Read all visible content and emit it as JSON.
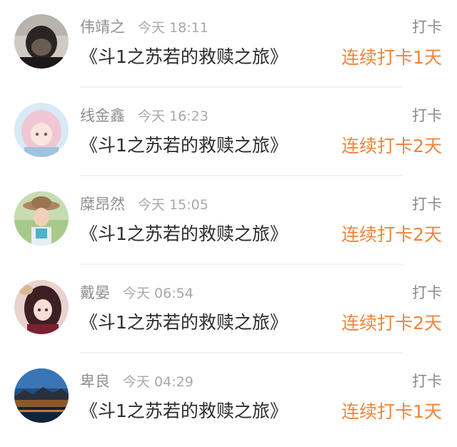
{
  "entries": [
    {
      "user": "伟靖之",
      "time": "今天 18:11",
      "action": "打卡",
      "book": "《斗1之苏若的救赎之旅》",
      "streak": "连续打卡1天",
      "avatar": "dark-portrait-avatar"
    },
    {
      "user": "线金鑫",
      "time": "今天 16:23",
      "action": "打卡",
      "book": "《斗1之苏若的救赎之旅》",
      "streak": "连续打卡2天",
      "avatar": "pink-hair-girl-avatar"
    },
    {
      "user": "糜昂然",
      "time": "今天 15:05",
      "action": "打卡",
      "book": "《斗1之苏若的救赎之旅》",
      "streak": "连续打卡2天",
      "avatar": "girl-with-hat-avatar"
    },
    {
      "user": "戴晏",
      "time": "今天 06:54",
      "action": "打卡",
      "book": "《斗1之苏若的救赎之旅》",
      "streak": "连续打卡2天",
      "avatar": "anime-girl-avatar"
    },
    {
      "user": "卑良",
      "time": "今天 04:29",
      "action": "打卡",
      "book": "《斗1之苏若的救赎之旅》",
      "streak": "连续打卡1天",
      "avatar": "night-landscape-avatar"
    }
  ],
  "colors": {
    "accent": "#f0843c",
    "username": "#8f8f8f",
    "text": "#2c2c2c"
  }
}
